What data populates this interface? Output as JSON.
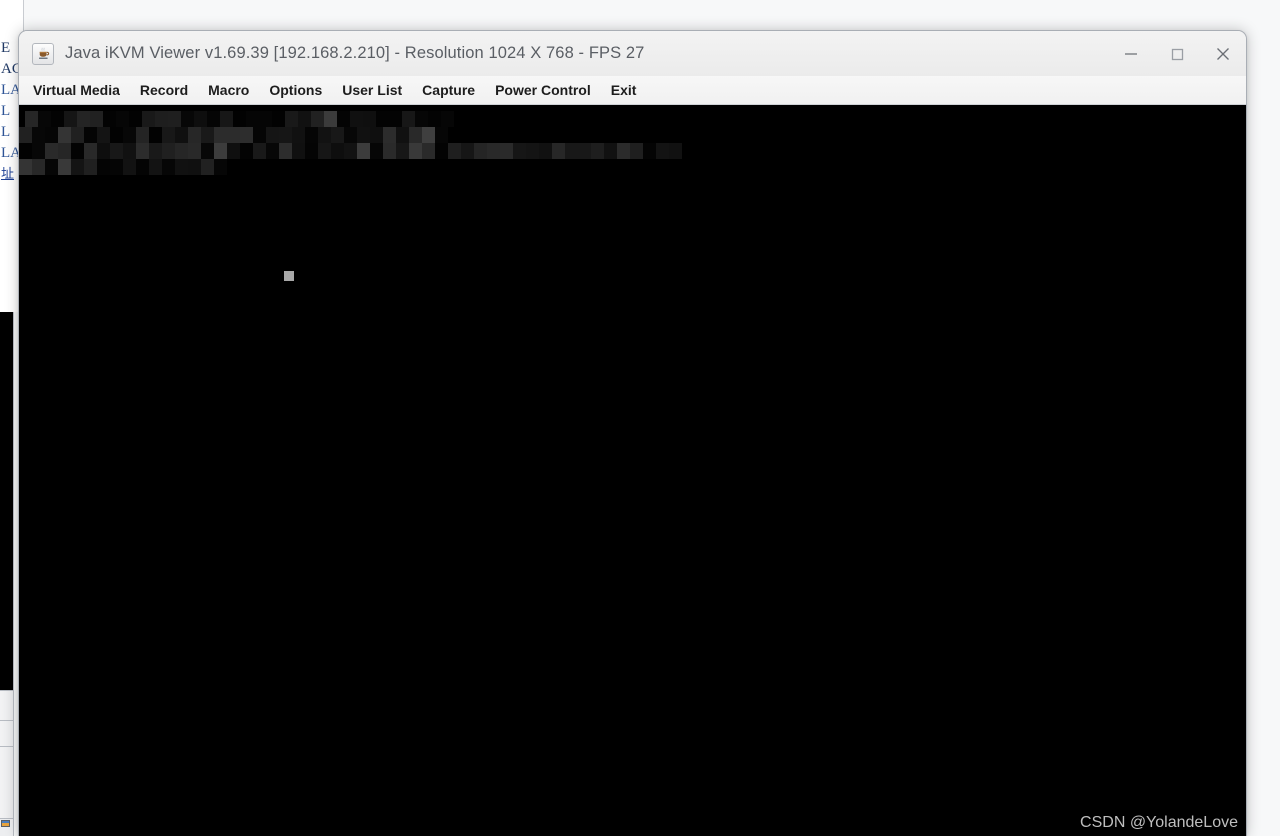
{
  "window": {
    "icon": "java-coffee-cup-icon",
    "title": "Java iKVM Viewer v1.69.39 [192.168.2.210]  - Resolution 1024 X 768 - FPS 27",
    "app_name": "Java iKVM Viewer",
    "version": "v1.69.39",
    "host_ip": "192.168.2.210",
    "resolution": "1024 X 768",
    "fps": "27",
    "controls": [
      {
        "name": "minimize-button",
        "icon": "minimize-icon",
        "label": "Minimize"
      },
      {
        "name": "maximize-button",
        "icon": "maximize-icon",
        "label": "Maximize"
      },
      {
        "name": "close-button",
        "icon": "close-icon",
        "label": "Close"
      }
    ]
  },
  "menubar": {
    "items": [
      {
        "label": "Virtual Media",
        "name": "menu-virtual-media"
      },
      {
        "label": "Record",
        "name": "menu-record"
      },
      {
        "label": "Macro",
        "name": "menu-macro"
      },
      {
        "label": "Options",
        "name": "menu-options"
      },
      {
        "label": "User List",
        "name": "menu-user-list"
      },
      {
        "label": "Capture",
        "name": "menu-capture"
      },
      {
        "label": "Power Control",
        "name": "menu-power-control"
      },
      {
        "label": "Exit",
        "name": "menu-exit"
      }
    ]
  },
  "remote_screen": {
    "background_color": "#000000",
    "redacted_note": "pixelated console text (obscured)",
    "cursor_color": "#a8a8a8"
  },
  "background_page": {
    "clipped_lines": [
      "E",
      "AC",
      "LA",
      "L",
      "L",
      "LA",
      "址"
    ]
  },
  "watermark": {
    "text": "CSDN @YolandeLove"
  },
  "colors": {
    "titlebar": "#efefef",
    "menubar": "#f4f4f4",
    "screen": "#000000",
    "window_border": "#a9aeb5",
    "title_text": "#5a5e64",
    "menu_text": "#1d1d1d"
  }
}
